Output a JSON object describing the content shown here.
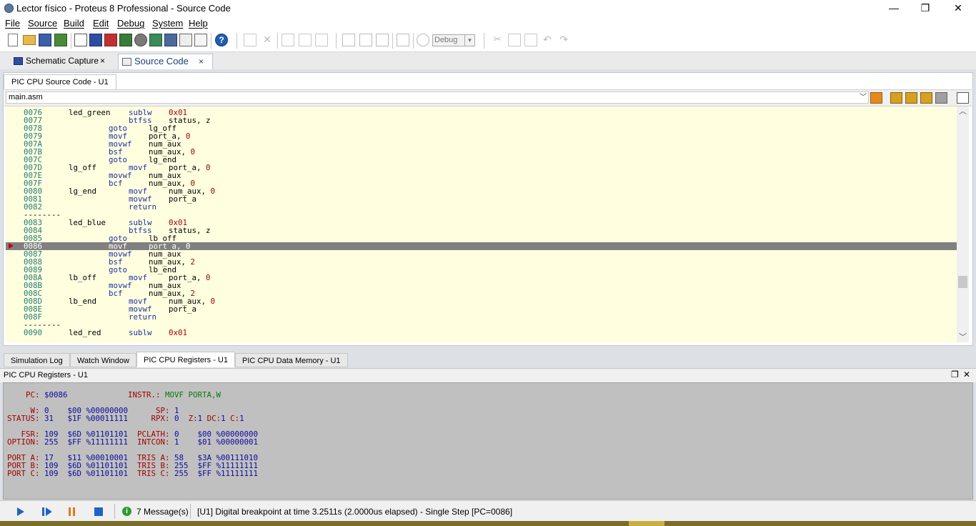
{
  "window": {
    "title": "Lector físico - Proteus 8 Professional - Source Code",
    "minimize_glyph": "—",
    "restore_glyph": "❐",
    "close_glyph": "✕"
  },
  "menu": [
    "File",
    "Source",
    "Build",
    "Edit",
    "Debug",
    "System",
    "Help"
  ],
  "toolbar": {
    "config_select": "Debug"
  },
  "doc_tabs": [
    {
      "label": "Schematic Capture",
      "close": "×"
    },
    {
      "label": "Source Code",
      "close": "×"
    }
  ],
  "source_pane": {
    "tab": "PIC CPU Source Code - U1",
    "file": "main.asm"
  },
  "code_lines": [
    {
      "addr": "0076",
      "label": "led_green",
      "op": "sublw",
      "op_col": "l",
      "args": "",
      "num": "0x01"
    },
    {
      "addr": "0077",
      "label": "",
      "op": "btfss",
      "op_col": "l",
      "args": "status, z",
      "num": ""
    },
    {
      "addr": "0078",
      "label": "",
      "op": "goto",
      "op_col": "i",
      "args": "lg_off",
      "num": ""
    },
    {
      "addr": "0079",
      "label": "",
      "op": "movf",
      "op_col": "i",
      "args": "port_a, ",
      "num": "0"
    },
    {
      "addr": "007A",
      "label": "",
      "op": "movwf",
      "op_col": "i",
      "args": "num_aux",
      "num": ""
    },
    {
      "addr": "007B",
      "label": "",
      "op": "bsf",
      "op_col": "i",
      "args": "num_aux, ",
      "num": "0"
    },
    {
      "addr": "007C",
      "label": "",
      "op": "goto",
      "op_col": "i",
      "args": "lg_end",
      "num": ""
    },
    {
      "addr": "007D",
      "label": "lg_off",
      "op": "movf",
      "op_col": "l",
      "args": "port_a, ",
      "num": "0"
    },
    {
      "addr": "007E",
      "label": "",
      "op": "movwf",
      "op_col": "i",
      "args": "num_aux",
      "num": ""
    },
    {
      "addr": "007F",
      "label": "",
      "op": "bcf",
      "op_col": "i",
      "args": "num_aux, ",
      "num": "0"
    },
    {
      "addr": "0080",
      "label": "lg_end",
      "op": "movf",
      "op_col": "l",
      "args": "num_aux, ",
      "num": "0"
    },
    {
      "addr": "0081",
      "label": "",
      "op": "movwf",
      "op_col": "l",
      "args": "port_a",
      "num": ""
    },
    {
      "addr": "0082",
      "label": "",
      "op": "return",
      "op_col": "l",
      "args": "",
      "num": ""
    },
    {
      "sep": "--------"
    },
    {
      "addr": "0083",
      "label": "led_blue",
      "op": "sublw",
      "op_col": "l",
      "args": "",
      "num": "0x01"
    },
    {
      "addr": "0084",
      "label": "",
      "op": "btfss",
      "op_col": "l",
      "args": "status, z",
      "num": ""
    },
    {
      "addr": "0085",
      "label": "",
      "op": "goto",
      "op_col": "i",
      "args": "lb_off",
      "num": ""
    },
    {
      "addr": "0086",
      "label": "",
      "op": "movf",
      "op_col": "i",
      "args": "port_a, ",
      "num": "0",
      "current": true
    },
    {
      "addr": "0087",
      "label": "",
      "op": "movwf",
      "op_col": "i",
      "args": "num_aux",
      "num": ""
    },
    {
      "addr": "0088",
      "label": "",
      "op": "bsf",
      "op_col": "i",
      "args": "num_aux, ",
      "num": "2"
    },
    {
      "addr": "0089",
      "label": "",
      "op": "goto",
      "op_col": "i",
      "args": "lb_end",
      "num": ""
    },
    {
      "addr": "008A",
      "label": "lb_off",
      "op": "movf",
      "op_col": "l",
      "args": "port_a, ",
      "num": "0"
    },
    {
      "addr": "008B",
      "label": "",
      "op": "movwf",
      "op_col": "i",
      "args": "num_aux",
      "num": ""
    },
    {
      "addr": "008C",
      "label": "",
      "op": "bcf",
      "op_col": "i",
      "args": "num_aux, ",
      "num": "2"
    },
    {
      "addr": "008D",
      "label": "lb_end",
      "op": "movf",
      "op_col": "l",
      "args": "num_aux, ",
      "num": "0"
    },
    {
      "addr": "008E",
      "label": "",
      "op": "movwf",
      "op_col": "l",
      "args": "port_a",
      "num": ""
    },
    {
      "addr": "008F",
      "label": "",
      "op": "return",
      "op_col": "l",
      "args": "",
      "num": ""
    },
    {
      "sep": "--------"
    },
    {
      "addr": "0090",
      "label": "led_red",
      "op": "sublw",
      "op_col": "l",
      "args": "",
      "num": "0x01"
    }
  ],
  "bottom_tabs": [
    "Simulation Log",
    "Watch Window",
    "PIC CPU Registers - U1",
    "PIC CPU Data Memory - U1"
  ],
  "registers": {
    "title": "PIC CPU Registers - U1",
    "restore_glyph": "❐",
    "close_glyph": "✕",
    "lines": [
      [
        {
          "t": "    PC: ",
          "c": "l"
        },
        {
          "t": "$0086",
          "c": "v"
        },
        {
          "t": "             INSTR.: ",
          "c": "l"
        },
        {
          "t": "MOVF PORTA,W",
          "c": "g"
        }
      ],
      [],
      [
        {
          "t": "     W: ",
          "c": "l"
        },
        {
          "t": "0    $00 %00000000",
          "c": "v"
        },
        {
          "t": "      SP: ",
          "c": "l"
        },
        {
          "t": "1",
          "c": "v"
        }
      ],
      [
        {
          "t": "STATUS: ",
          "c": "l"
        },
        {
          "t": "31   $1F %00011111",
          "c": "v"
        },
        {
          "t": "     RPX: ",
          "c": "l"
        },
        {
          "t": "0  ",
          "c": "v"
        },
        {
          "t": "Z:",
          "c": "l"
        },
        {
          "t": "1 ",
          "c": "v"
        },
        {
          "t": "DC:",
          "c": "l"
        },
        {
          "t": "1 ",
          "c": "v"
        },
        {
          "t": "C:",
          "c": "l"
        },
        {
          "t": "1",
          "c": "v"
        }
      ],
      [],
      [
        {
          "t": "   FSR: ",
          "c": "l"
        },
        {
          "t": "109  $6D %01101101",
          "c": "v"
        },
        {
          "t": "  PCLATH: ",
          "c": "l"
        },
        {
          "t": "0    $00 %00000000",
          "c": "v"
        }
      ],
      [
        {
          "t": "OPTION: ",
          "c": "l"
        },
        {
          "t": "255  $FF %11111111",
          "c": "v"
        },
        {
          "t": "  INTCON: ",
          "c": "l"
        },
        {
          "t": "1    $01 %00000001",
          "c": "v"
        }
      ],
      [],
      [
        {
          "t": "PORT A: ",
          "c": "l"
        },
        {
          "t": "17   $11 %00010001",
          "c": "v"
        },
        {
          "t": "  TRIS A: ",
          "c": "l"
        },
        {
          "t": "58   $3A %00111010",
          "c": "v"
        }
      ],
      [
        {
          "t": "PORT B: ",
          "c": "l"
        },
        {
          "t": "109  $6D %01101101",
          "c": "v"
        },
        {
          "t": "  TRIS B: ",
          "c": "l"
        },
        {
          "t": "255  $FF %11111111",
          "c": "v"
        }
      ],
      [
        {
          "t": "PORT C: ",
          "c": "l"
        },
        {
          "t": "109  $6D %01101101",
          "c": "v"
        },
        {
          "t": "  TRIS C: ",
          "c": "l"
        },
        {
          "t": "255  $FF %11111111",
          "c": "v"
        }
      ]
    ]
  },
  "status": {
    "info_glyph": "i",
    "messages": "7 Message(s)",
    "text": "[U1] Digital breakpoint at time 3.2511s (2.0000us elapsed) - Single Step [PC=0086]"
  }
}
